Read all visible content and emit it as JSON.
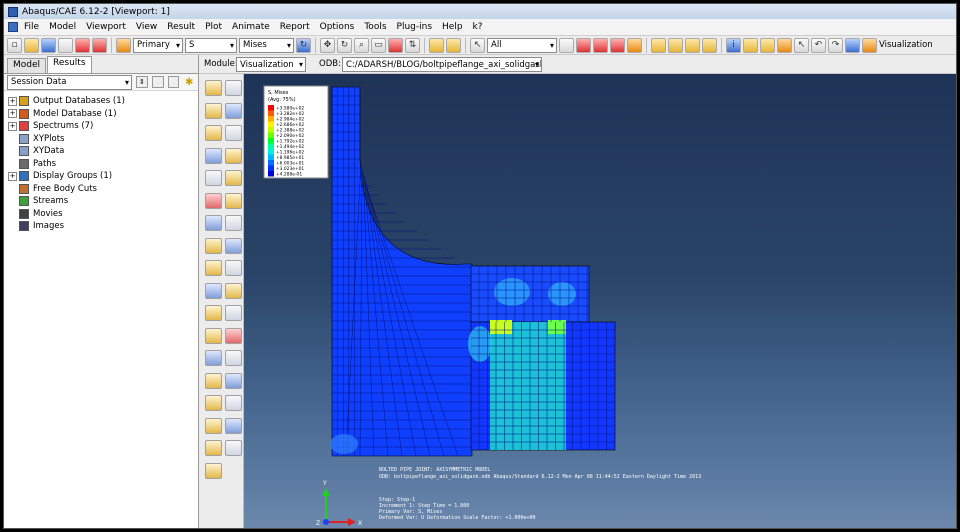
{
  "window": {
    "title": "Abaqus/CAE 6.12-2 [Viewport: 1]"
  },
  "menu": [
    "File",
    "Model",
    "Viewport",
    "View",
    "Result",
    "Plot",
    "Animate",
    "Report",
    "Options",
    "Tools",
    "Plug-ins",
    "Help",
    "k?"
  ],
  "toolbar": {
    "primary_label": "Primary",
    "variable": "S",
    "invariant": "Mises",
    "filter": "All",
    "visualization_label": "Visualization"
  },
  "context": {
    "module_label": "Module:",
    "module_value": "Visualization",
    "odb_label": "ODB:",
    "odb_value": "C:/ADARSH/BLOG/boltpipeflange_axi_solidgask.odb"
  },
  "left_panel": {
    "tabs": [
      "Model",
      "Results"
    ],
    "session_select": "Session Data",
    "tree": [
      {
        "label": "Output Databases (1)",
        "expandable": true,
        "icon_color": "#d8a020"
      },
      {
        "label": "Model Database (1)",
        "expandable": true,
        "icon_color": "#d05a20"
      },
      {
        "label": "Spectrums (7)",
        "expandable": true,
        "icon_color": "#e04040"
      },
      {
        "label": "XYPlots",
        "expandable": false,
        "icon_color": "#8aa0c8"
      },
      {
        "label": "XYData",
        "expandable": false,
        "icon_color": "#8aa0c8"
      },
      {
        "label": "Paths",
        "expandable": false,
        "icon_color": "#6a6a6a"
      },
      {
        "label": "Display Groups (1)",
        "expandable": true,
        "icon_color": "#3070c0"
      },
      {
        "label": "Free Body Cuts",
        "expandable": false,
        "icon_color": "#c07030"
      },
      {
        "label": "Streams",
        "expandable": false,
        "icon_color": "#40a040"
      },
      {
        "label": "Movies",
        "expandable": false,
        "icon_color": "#404040"
      },
      {
        "label": "Images",
        "expandable": false,
        "icon_color": "#404060"
      }
    ]
  },
  "legend": {
    "title": "S, Mises",
    "subtitle": "(Avg: 75%)",
    "values": [
      "+3.580e+02",
      "+3.282e+02",
      "+2.984e+02",
      "+2.686e+02",
      "+2.388e+02",
      "+2.090e+02",
      "+1.792e+02",
      "+1.494e+02",
      "+1.196e+02",
      "+8.985e+01",
      "+6.003e+01",
      "+3.023e+01",
      "+4.288e-01"
    ],
    "colors": [
      "#ff0000",
      "#ff5a00",
      "#ffae00",
      "#fff200",
      "#c0ff00",
      "#6cff00",
      "#00ff30",
      "#00ff9c",
      "#00f0e8",
      "#00b8ff",
      "#0070ff",
      "#0030ff",
      "#0000d8"
    ]
  },
  "model_info": {
    "line1": "BOLTED PIPE JOINT: AXISYMMETRIC MODEL",
    "line2": "ODB: boltpipeflange_axi_solidgask.odb    Abaqus/Standard 6.12-2    Mon Apr 08 11:44:52 Eastern Daylight Time 2013",
    "step": "Step: Step-1",
    "increment": "Increment     1: Step Time =     1.000",
    "primary_var": "Primary Var: S, Mises",
    "deformed_var": "Deformed Var: U   Deformation Scale Factor: +1.000e+00"
  },
  "triad": {
    "y": "Y",
    "x": "X",
    "z": "Z"
  }
}
